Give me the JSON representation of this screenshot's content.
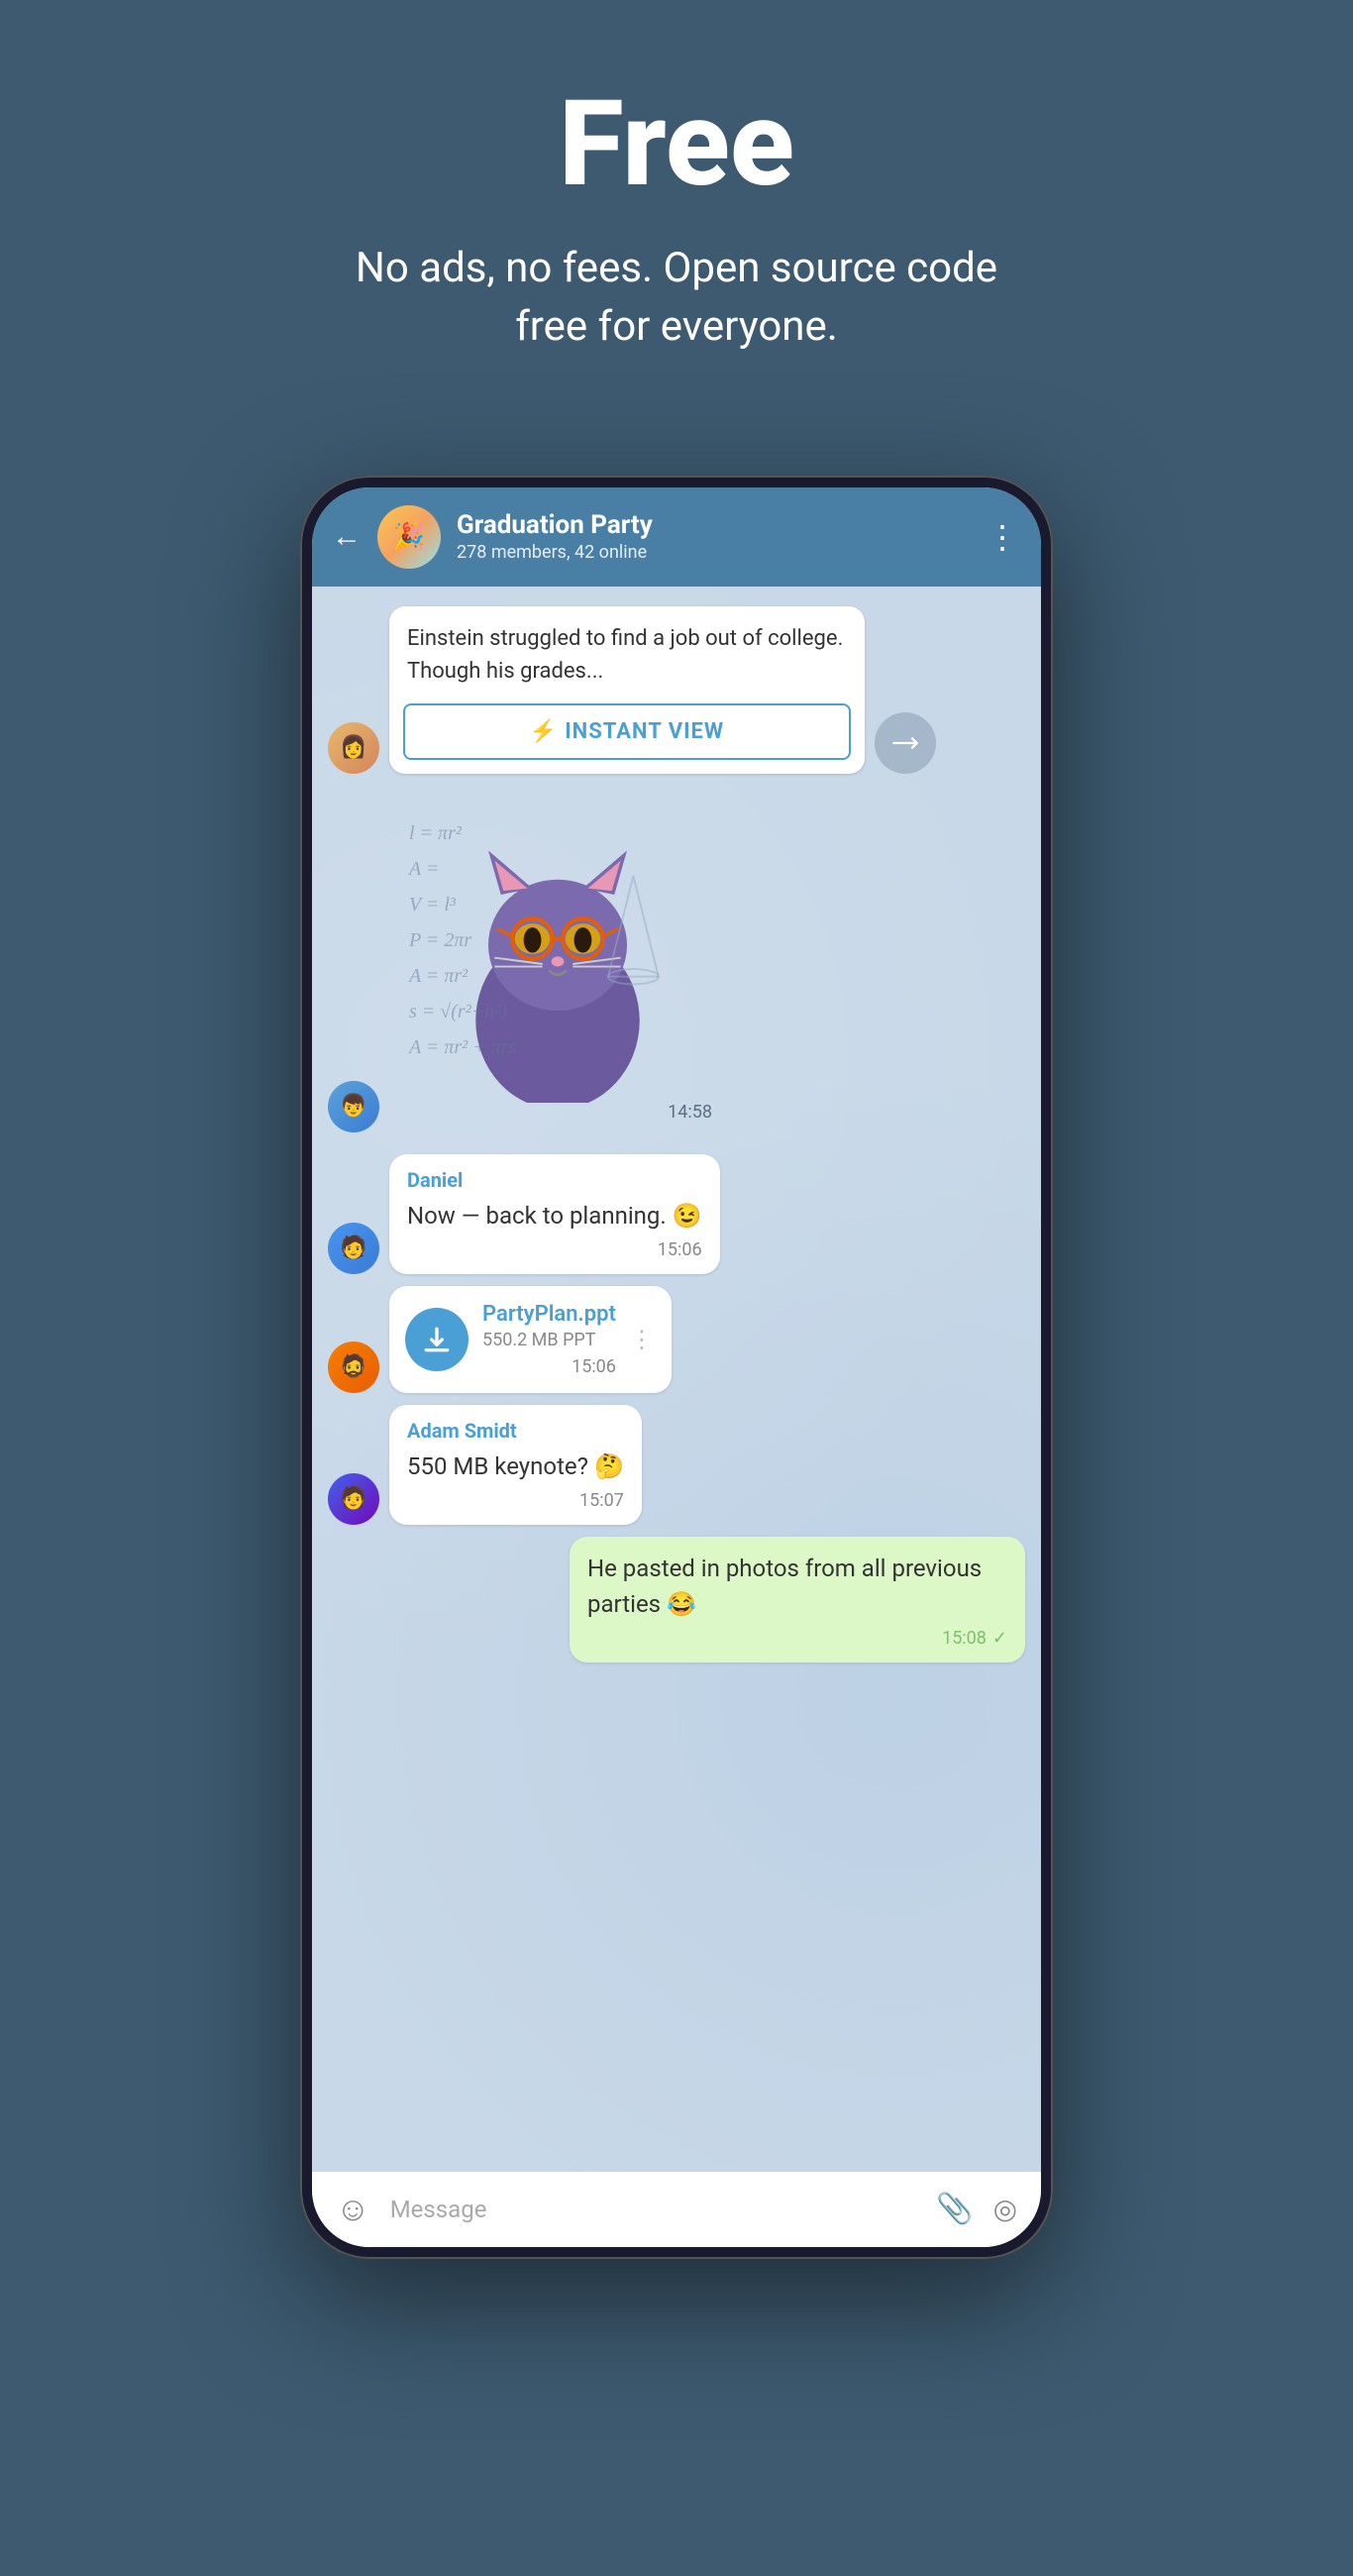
{
  "hero": {
    "title": "Free",
    "subtitle": "No ads, no fees. Open source code free for everyone."
  },
  "chat": {
    "back_label": "←",
    "name": "Graduation Party",
    "meta": "278 members, 42 online",
    "more": "⋮"
  },
  "messages": {
    "article_text": "Einstein struggled to find a job out of college. Though his grades...",
    "instant_view_label": "INSTANT VIEW",
    "sticker_time": "14:58",
    "msg1_sender": "Daniel",
    "msg1_text": "Now — back to planning. 😉",
    "msg1_time": "15:06",
    "file_name": "PartyPlan.ppt",
    "file_size": "550.2 MB PPT",
    "file_time": "15:06",
    "msg2_sender": "Adam Smidt",
    "msg2_text": "550 MB keynote? 🤔",
    "msg2_time": "15:07",
    "msg3_text": "He pasted in photos from all previous parties 😂",
    "msg3_time": "15:08",
    "input_placeholder": "Message"
  },
  "math": {
    "lines": [
      "l = πr²",
      "A =",
      "V = l³",
      "P = 2πr",
      "A = πr²",
      "s = √(r²+h²)",
      "A = πr² + πrs"
    ]
  },
  "icons": {
    "bolt": "⚡",
    "share": "↗",
    "download": "↓",
    "emoji": "☺",
    "attach": "📎",
    "camera": "◎",
    "check": "✓"
  }
}
